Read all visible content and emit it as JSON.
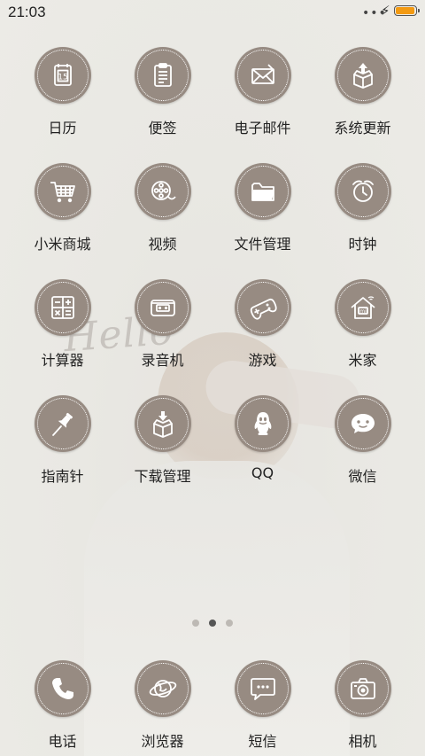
{
  "status_bar": {
    "time": "21:03",
    "dots": "•••",
    "charging_icon": "lightning-icon",
    "battery_level": 0.95,
    "battery_color": "#f39a12"
  },
  "wallpaper": {
    "handwriting": "Hello"
  },
  "theme": {
    "icon_background": "#978b82",
    "icon_foreground": "#ffffff"
  },
  "apps": [
    {
      "label": "日历",
      "icon": "calendar-icon"
    },
    {
      "label": "便签",
      "icon": "notepad-icon"
    },
    {
      "label": "电子邮件",
      "icon": "mail-icon"
    },
    {
      "label": "系统更新",
      "icon": "update-box-icon"
    },
    {
      "label": "小米商城",
      "icon": "shopping-cart-icon"
    },
    {
      "label": "视频",
      "icon": "video-reel-icon"
    },
    {
      "label": "文件管理",
      "icon": "folder-icon"
    },
    {
      "label": "时钟",
      "icon": "clock-icon"
    },
    {
      "label": "计算器",
      "icon": "calculator-icon"
    },
    {
      "label": "录音机",
      "icon": "recorder-icon"
    },
    {
      "label": "游戏",
      "icon": "gamepad-icon"
    },
    {
      "label": "米家",
      "icon": "home-icon"
    },
    {
      "label": "指南针",
      "icon": "pushpin-icon"
    },
    {
      "label": "下载管理",
      "icon": "download-box-icon"
    },
    {
      "label": "QQ",
      "icon": "qq-penguin-icon"
    },
    {
      "label": "微信",
      "icon": "wechat-icon"
    }
  ],
  "page_indicator": {
    "pages": 3,
    "active": 1
  },
  "dock": [
    {
      "label": "电话",
      "icon": "phone-icon"
    },
    {
      "label": "浏览器",
      "icon": "browser-globe-icon"
    },
    {
      "label": "短信",
      "icon": "message-bubble-icon"
    },
    {
      "label": "相机",
      "icon": "camera-icon"
    }
  ]
}
